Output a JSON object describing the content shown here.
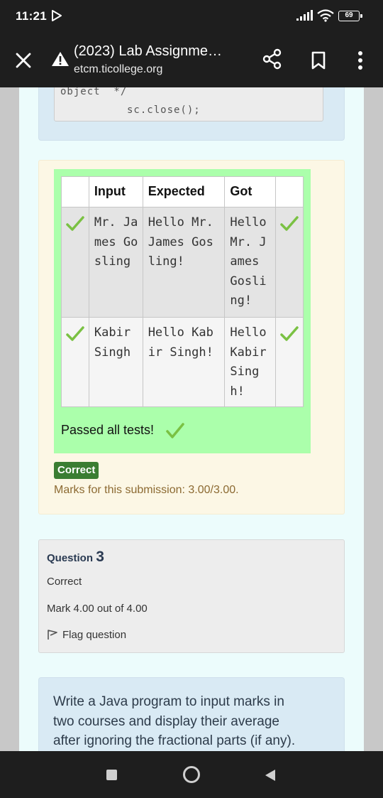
{
  "status_bar": {
    "time": "11:21",
    "battery": "69"
  },
  "tab": {
    "title": "(2023) Lab Assignme…",
    "url": "etcm.ticollege.org"
  },
  "code": {
    "line1": "object  */",
    "line2": "sc.close();"
  },
  "results_table": {
    "headers": [
      "",
      "Input",
      "Expected",
      "Got",
      ""
    ],
    "rows": [
      {
        "input": "Mr. James Gosling",
        "expected": "Hello Mr. James Gosling!",
        "got": "Hello Mr. James Gosling!"
      },
      {
        "input": "Kabir Singh",
        "expected": "Hello Kabir Singh!",
        "got": "Hello Kabir Singh!"
      }
    ],
    "summary": "Passed all tests!"
  },
  "grading": {
    "badge": "Correct",
    "marks": "Marks for this submission: 3.00/3.00."
  },
  "question_info": {
    "label": "Question",
    "number": "3",
    "state": "Correct",
    "grade": "Mark 4.00 out of 4.00",
    "flag": "Flag question"
  },
  "question_text": "Write a Java program to input marks in two courses and display their average after ignoring the fractional parts (if any).",
  "colors": {
    "pass_green": "#abffab",
    "tick_green": "#7ac143",
    "correct_badge": "#3a7d32",
    "marks_text": "#8c6a32"
  }
}
